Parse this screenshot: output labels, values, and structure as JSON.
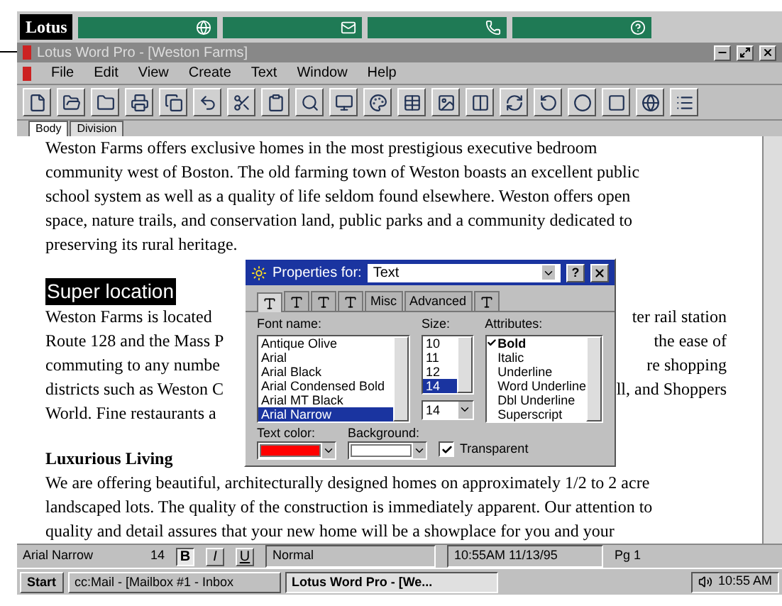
{
  "smartcenter": {
    "logo": "Lotus"
  },
  "window": {
    "title": "Lotus Word Pro - [Weston Farms]"
  },
  "menu": [
    "File",
    "Edit",
    "View",
    "Create",
    "Text",
    "Window",
    "Help"
  ],
  "division_tabs": [
    {
      "label": "Body",
      "selected": true
    },
    {
      "label": "Division",
      "selected": false
    }
  ],
  "document": {
    "paragraph_1": [
      "Weston Farms offers exclusive homes in the most prestigious executive bedroom",
      "community west of Boston. The old farming town of Weston boasts an excellent public",
      "school system as well as a quality of life seldom found elsewhere. Weston offers open",
      "space, nature trails, and conservation land, public parks and a community dedicated to",
      "preserving its rural heritage."
    ],
    "heading_1": {
      "text": "Super location",
      "selected": true
    },
    "paragraph_2": [
      {
        "left": "Weston Farms is located",
        "right": "ter rail station"
      },
      {
        "left": "Route 128 and the Mass P",
        "right": "the ease of"
      },
      {
        "left": "commuting to any numbe",
        "right": "re shopping"
      },
      {
        "left": "districts such as Weston C",
        "right": "ll, and Shoppers"
      },
      {
        "left": "World. Fine restaurants a"
      }
    ],
    "heading_2": "Luxurious Living",
    "paragraph_3": [
      "We are offering beautiful, architecturally designed homes on approximately 1/2 to 2 acre",
      "landscaped lots. The quality of the construction is immediately apparent. Our attention to",
      "quality and detail assures that your new home will be a showplace for you and your"
    ]
  },
  "properties_dialog": {
    "title": "Properties for:",
    "target": "Text",
    "help_button": "?",
    "tabs": [
      {
        "kind": "icon",
        "selected": true
      },
      {
        "kind": "icon",
        "selected": false
      },
      {
        "kind": "icon",
        "selected": false
      },
      {
        "kind": "icon",
        "selected": false
      },
      {
        "kind": "text",
        "label": "Misc",
        "selected": false
      },
      {
        "kind": "text",
        "label": "Advanced",
        "selected": false
      },
      {
        "kind": "icon",
        "selected": false
      }
    ],
    "font_name_label": "Font name:",
    "fonts": [
      {
        "label": "Antique Olive",
        "selected": false
      },
      {
        "label": "Arial",
        "selected": false
      },
      {
        "label": "Arial Black",
        "selected": false
      },
      {
        "label": "Arial Condensed Bold",
        "selected": false
      },
      {
        "label": "Arial MT Black",
        "selected": false
      },
      {
        "label": "Arial Narrow",
        "selected": true
      }
    ],
    "size_label": "Size:",
    "sizes": [
      {
        "label": "10",
        "selected": false
      },
      {
        "label": "11",
        "selected": false
      },
      {
        "label": "12",
        "selected": false
      },
      {
        "label": "14",
        "selected": true
      }
    ],
    "size_value": "14",
    "attributes_label": "Attributes:",
    "attributes": [
      {
        "label": "Bold",
        "checked": true
      },
      {
        "label": "Italic",
        "checked": false
      },
      {
        "label": "Underline",
        "checked": false
      },
      {
        "label": "Word Underline",
        "checked": false
      },
      {
        "label": "Dbl Underline",
        "checked": false
      },
      {
        "label": "Superscript",
        "checked": false
      }
    ],
    "color_fields": [
      {
        "label": "Text color:",
        "color": "#ff0000"
      },
      {
        "label": "Background:",
        "color": "#ffffff"
      }
    ],
    "transparent": {
      "label": "Transparent",
      "checked": true
    }
  },
  "status_bar": {
    "font": "Arial Narrow",
    "size": "14",
    "bold": {
      "label": "B",
      "on": true
    },
    "italic": {
      "label": "I",
      "on": false
    },
    "underline": {
      "label": "U",
      "on": false
    },
    "style": "Normal",
    "datetime": "10:55AM  11/13/95",
    "page": "Pg 1"
  },
  "taskbar": {
    "start": "Start",
    "tasks": [
      {
        "label": "cc:Mail - [Mailbox #1 - Inbox",
        "selected": false
      },
      {
        "label": "Lotus Word Pro - [We...",
        "selected": true
      }
    ],
    "clock": "10:55 AM"
  }
}
